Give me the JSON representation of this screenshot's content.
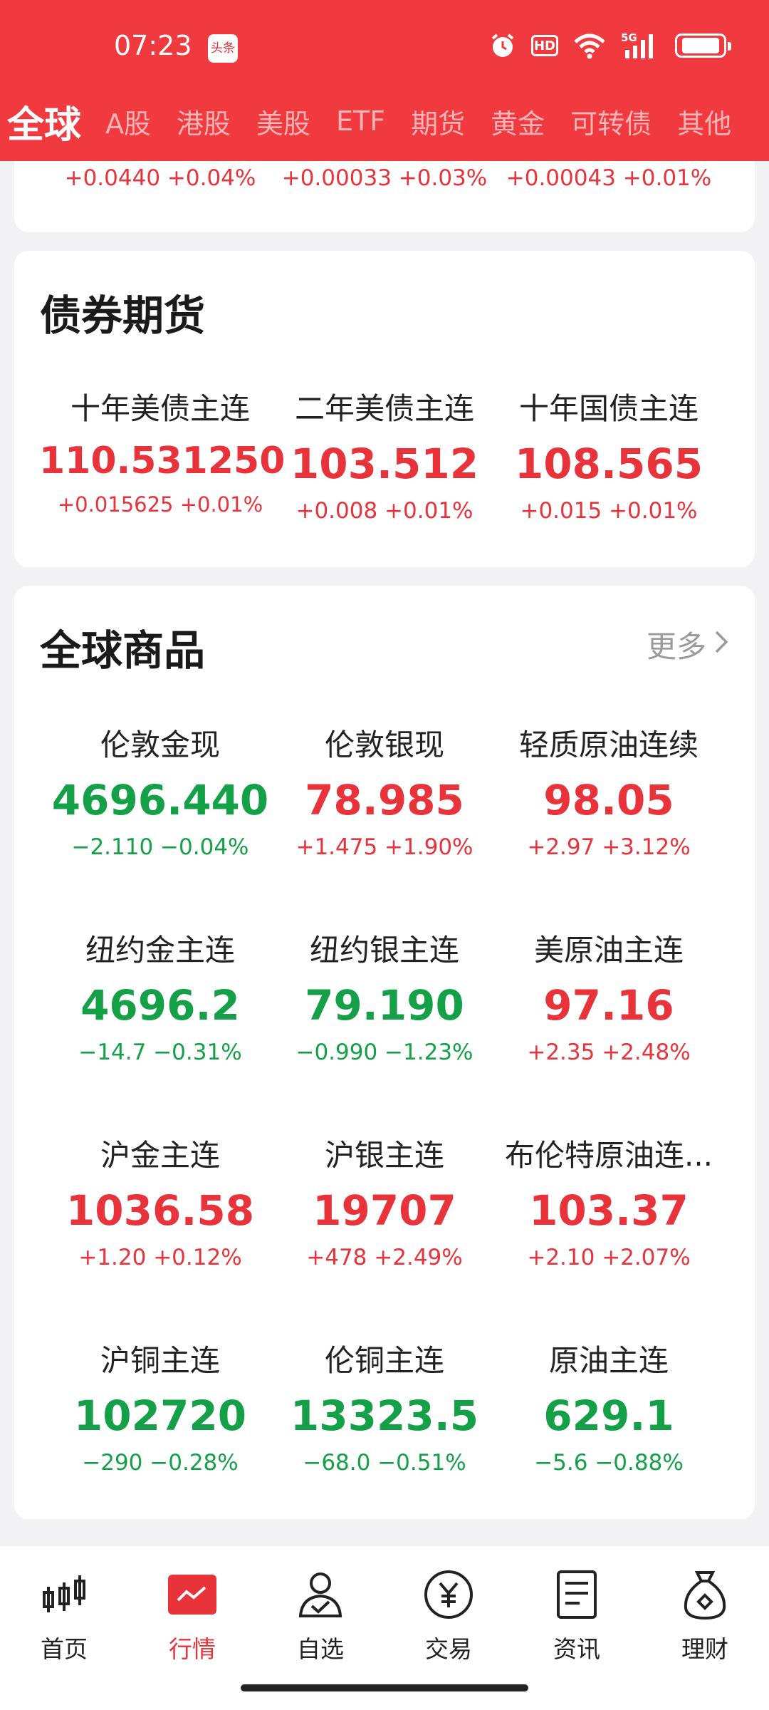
{
  "status": {
    "time": "07:23",
    "app_badge": "头条",
    "hd": "HD",
    "network": "5G"
  },
  "tabs": [
    "全球",
    "A股",
    "港股",
    "美股",
    "ETF",
    "期货",
    "黄金",
    "可转债",
    "其他"
  ],
  "top_partial": [
    {
      "change": "+0.0440 +0.04%"
    },
    {
      "change": "+0.00033 +0.03%"
    },
    {
      "change": "+0.00043 +0.01%"
    }
  ],
  "bond": {
    "title": "债券期货",
    "items": [
      {
        "name": "十年美债主连",
        "price": "110.531250",
        "change": "+0.015625 +0.01%"
      },
      {
        "name": "二年美债主连",
        "price": "103.512",
        "change": "+0.008 +0.01%"
      },
      {
        "name": "十年国债主连",
        "price": "108.565",
        "change": "+0.015 +0.01%"
      }
    ]
  },
  "commodities": {
    "title": "全球商品",
    "more": "更多",
    "items": [
      {
        "name": "伦敦金现",
        "price": "4696.440",
        "change": "−2.110 −0.04%",
        "trend": "down"
      },
      {
        "name": "伦敦银现",
        "price": "78.985",
        "change": "+1.475 +1.90%",
        "trend": "up"
      },
      {
        "name": "轻质原油连续",
        "price": "98.05",
        "change": "+2.97 +3.12%",
        "trend": "up"
      },
      {
        "name": "纽约金主连",
        "price": "4696.2",
        "change": "−14.7 −0.31%",
        "trend": "down"
      },
      {
        "name": "纽约银主连",
        "price": "79.190",
        "change": "−0.990 −1.23%",
        "trend": "down"
      },
      {
        "name": "美原油主连",
        "price": "97.16",
        "change": "+2.35 +2.48%",
        "trend": "up"
      },
      {
        "name": "沪金主连",
        "price": "1036.58",
        "change": "+1.20 +0.12%",
        "trend": "up"
      },
      {
        "name": "沪银主连",
        "price": "19707",
        "change": "+478 +2.49%",
        "trend": "up"
      },
      {
        "name": "布伦特原油连...",
        "price": "103.37",
        "change": "+2.10 +2.07%",
        "trend": "up"
      },
      {
        "name": "沪铜主连",
        "price": "102720",
        "change": "−290 −0.28%",
        "trend": "down"
      },
      {
        "name": "伦铜主连",
        "price": "13323.5",
        "change": "−68.0 −0.51%",
        "trend": "down"
      },
      {
        "name": "原油主连",
        "price": "629.1",
        "change": "−5.6 −0.88%",
        "trend": "down"
      }
    ]
  },
  "nav": [
    {
      "label": "首页",
      "icon": "candlestick-icon"
    },
    {
      "label": "行情",
      "icon": "market-chart-icon",
      "active": true
    },
    {
      "label": "自选",
      "icon": "user-check-icon"
    },
    {
      "label": "交易",
      "icon": "yen-circle-icon"
    },
    {
      "label": "资讯",
      "icon": "document-icon"
    },
    {
      "label": "理财",
      "icon": "money-bag-icon"
    }
  ],
  "colors": {
    "header": "#f03a40",
    "up": "#e8333b",
    "down": "#14a046"
  }
}
